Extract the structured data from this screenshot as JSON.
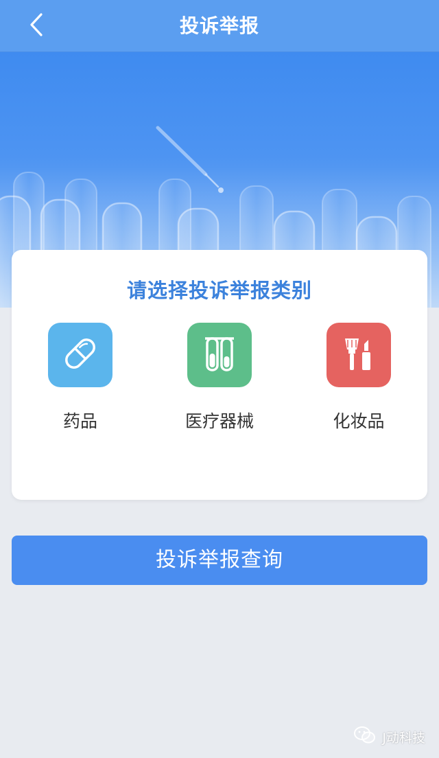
{
  "navbar": {
    "title": "投诉举报",
    "back_icon": "chevron-left-icon"
  },
  "card": {
    "title": "请选择投诉举报类别",
    "categories": [
      {
        "label": "药品",
        "icon": "pill-capsule-icon",
        "color": "#5bb5ec"
      },
      {
        "label": "医疗器械",
        "icon": "test-tubes-icon",
        "color": "#5dbe8a"
      },
      {
        "label": "化妆品",
        "icon": "makeup-brush-lipstick-icon",
        "color": "#e56360"
      }
    ]
  },
  "query_button": {
    "label": "投诉举报查询"
  },
  "watermark": {
    "text": "J动科技"
  },
  "colors": {
    "navbar": "#5b9ef0",
    "accent": "#4a8df0",
    "card_title": "#3c82dc",
    "background": "#e8ebf0"
  }
}
